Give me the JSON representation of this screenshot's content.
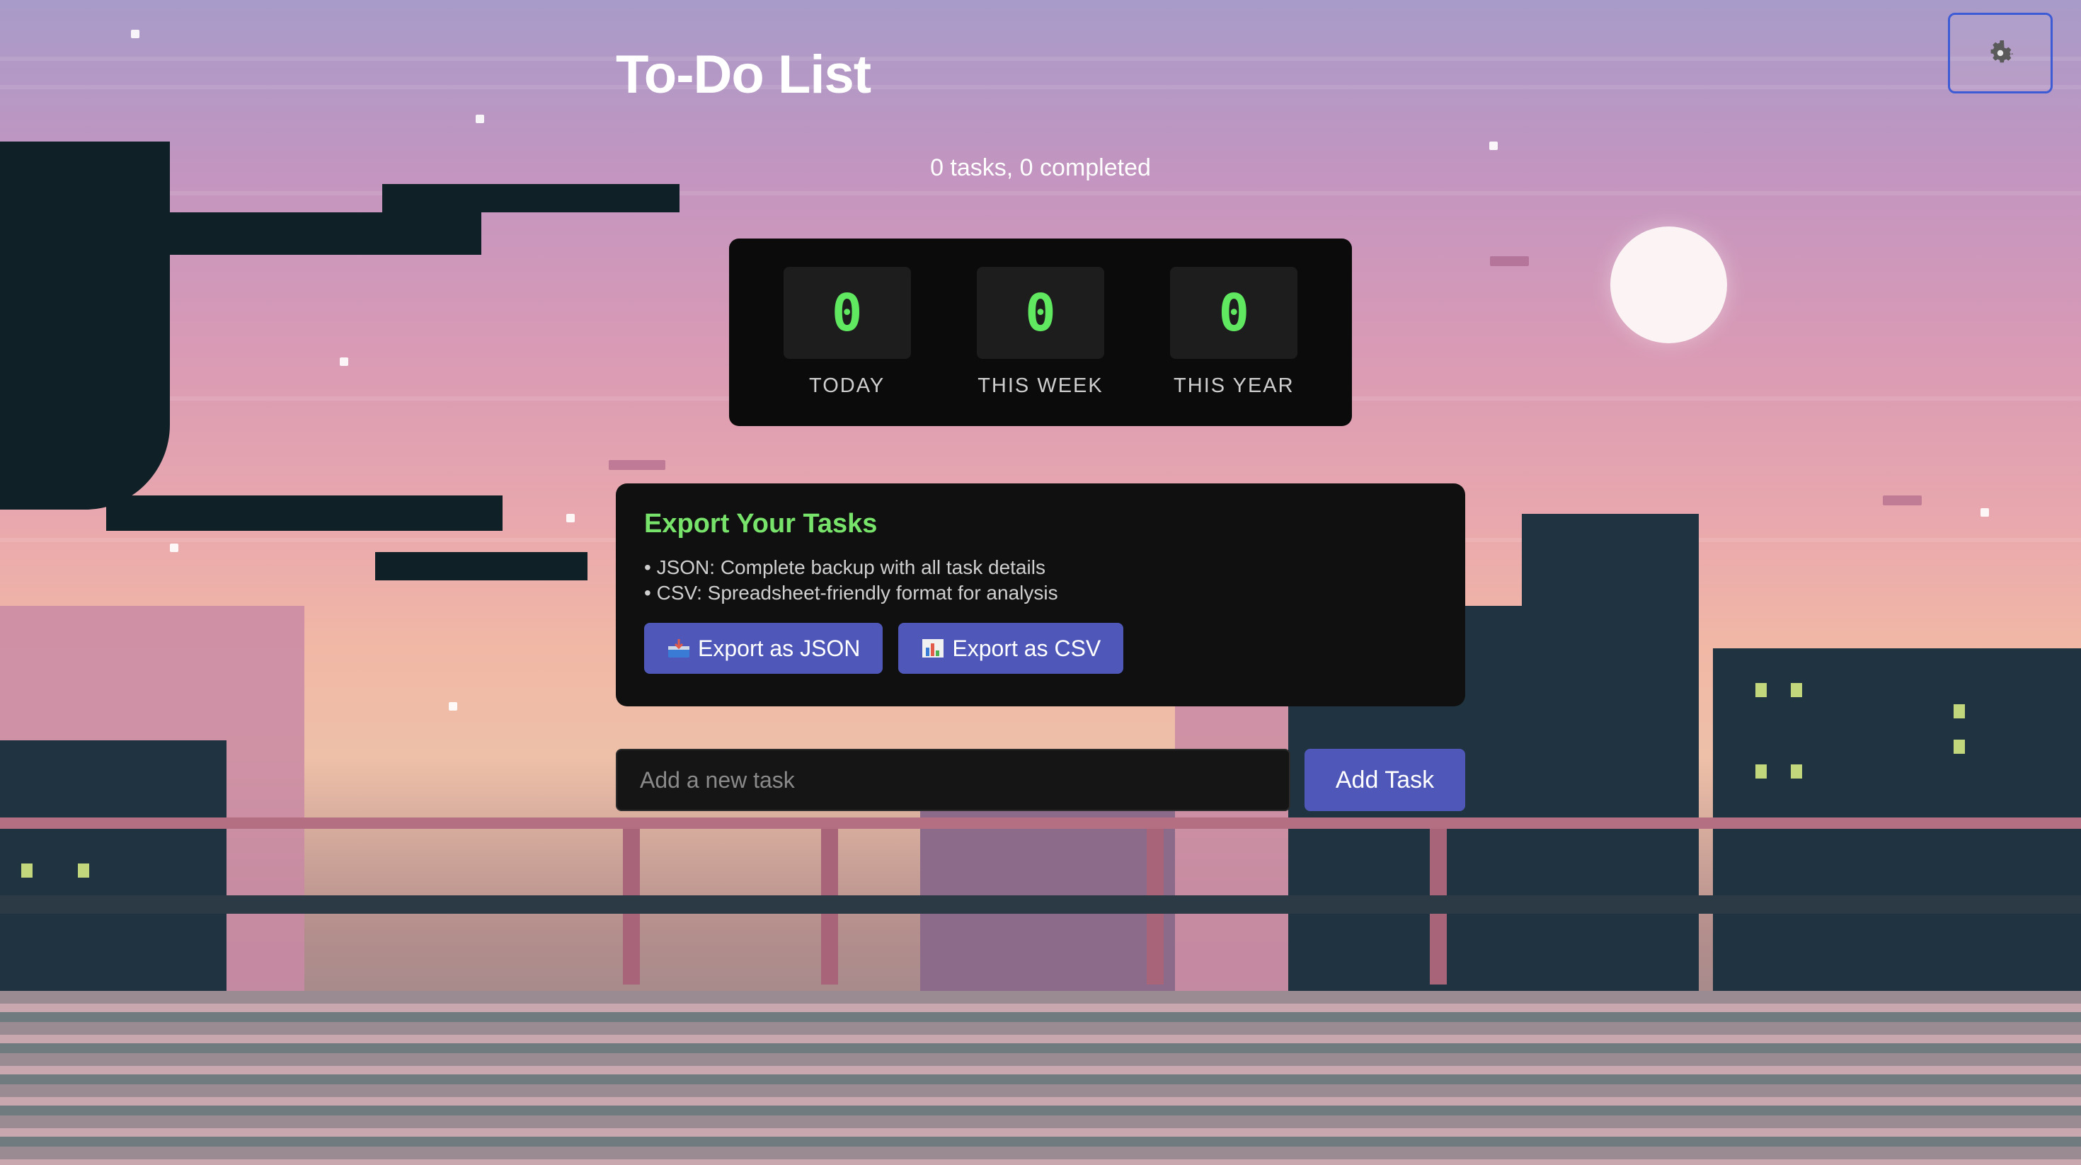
{
  "app": {
    "title": "To-Do List",
    "summary": "0 tasks, 0 completed"
  },
  "settings": {
    "icon": "gear-icon"
  },
  "stats": [
    {
      "value": "0",
      "label": "TODAY"
    },
    {
      "value": "0",
      "label": "THIS WEEK"
    },
    {
      "value": "0",
      "label": "THIS YEAR"
    }
  ],
  "export": {
    "title": "Export Your Tasks",
    "items": [
      "JSON: Complete backup with all task details",
      "CSV: Spreadsheet-friendly format for analysis"
    ],
    "json_button": "Export as JSON",
    "csv_button": "Export as CSV"
  },
  "task_form": {
    "placeholder": "Add a new task",
    "value": "",
    "add_button": "Add Task"
  },
  "colors": {
    "accent_button": "#4f58b8",
    "stat_digit": "#5fe860",
    "export_title": "#78e36a",
    "panel_bg": "#101010"
  }
}
